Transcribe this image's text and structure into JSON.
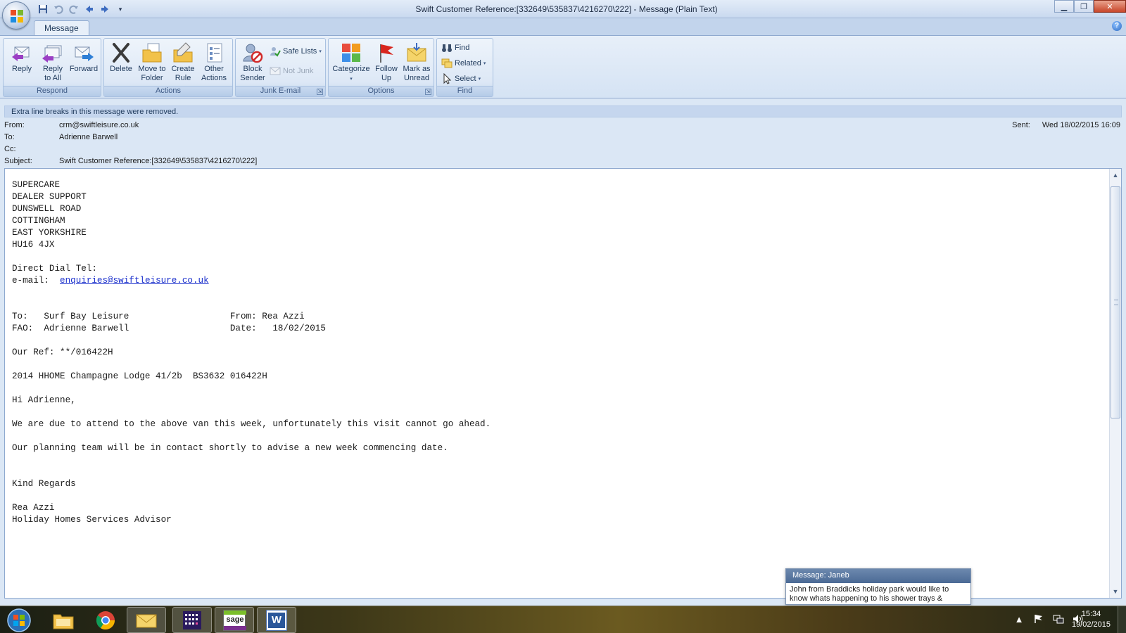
{
  "window": {
    "title": "Swift Customer Reference:[332649\\535837\\4216270\\222] - Message (Plain Text)",
    "controls": {
      "minimize": "▁",
      "maximize": "❐",
      "close": "✕"
    }
  },
  "ribbon": {
    "tab": "Message",
    "groups": {
      "respond": {
        "label": "Respond",
        "reply": "Reply",
        "reply_all": "Reply\nto All",
        "forward": "Forward"
      },
      "actions": {
        "label": "Actions",
        "delete": "Delete",
        "move": "Move to\nFolder",
        "create_rule": "Create\nRule",
        "other_actions": "Other\nActions"
      },
      "junk": {
        "label": "Junk E-mail",
        "block_sender": "Block\nSender",
        "safe_lists": "Safe Lists",
        "not_junk": "Not Junk"
      },
      "options": {
        "label": "Options",
        "categorize": "Categorize",
        "follow_up": "Follow\nUp",
        "mark_unread": "Mark as\nUnread"
      },
      "find": {
        "label": "Find",
        "find": "Find",
        "related": "Related",
        "select": "Select"
      }
    }
  },
  "infobar": "Extra line breaks in this message were removed.",
  "headers": {
    "from_label": "From:",
    "from": "crm@swiftleisure.co.uk",
    "to_label": "To:",
    "to": "Adrienne Barwell",
    "cc_label": "Cc:",
    "cc": "",
    "subject_label": "Subject:",
    "subject": "Swift Customer Reference:[332649\\535837\\4216270\\222]",
    "sent_label": "Sent:",
    "sent": "Wed 18/02/2015 16:09"
  },
  "body": {
    "address": "SUPERCARE\nDEALER SUPPORT\nDUNSWELL ROAD\nCOTTINGHAM\nEAST YORKSHIRE\nHU16 4JX\n\nDirect Dial Tel:",
    "email_label": "e-mail:  ",
    "email_link": "enquiries@swiftleisure.co.uk",
    "main": "\n\n\nTo:   Surf Bay Leisure                   From: Rea Azzi\nFAO:  Adrienne Barwell                   Date:   18/02/2015\n\nOur Ref: **/016422H\n\n2014 HHOME Champagne Lodge 41/2b  BS3632 016422H\n\nHi Adrienne,\n\nWe are due to attend to the above van this week, unfortunately this visit cannot go ahead.\n\nOur planning team will be in contact shortly to advise a new week commencing date.\n\n\nKind Regards\n\nRea Azzi\nHoliday Homes Services Advisor"
  },
  "notification": {
    "title": "Message: Janeb",
    "text": "John from Braddicks holiday park   would like to know whats happening to his shower trays &"
  },
  "taskbar": {
    "apps": [
      "explorer-icon",
      "chrome-icon",
      "outlook-icon",
      "calendar-app-icon",
      "sage-icon",
      "word-icon"
    ],
    "sage_label": "sage",
    "word_label": "W",
    "time": "15:34",
    "date": "19/02/2015"
  }
}
